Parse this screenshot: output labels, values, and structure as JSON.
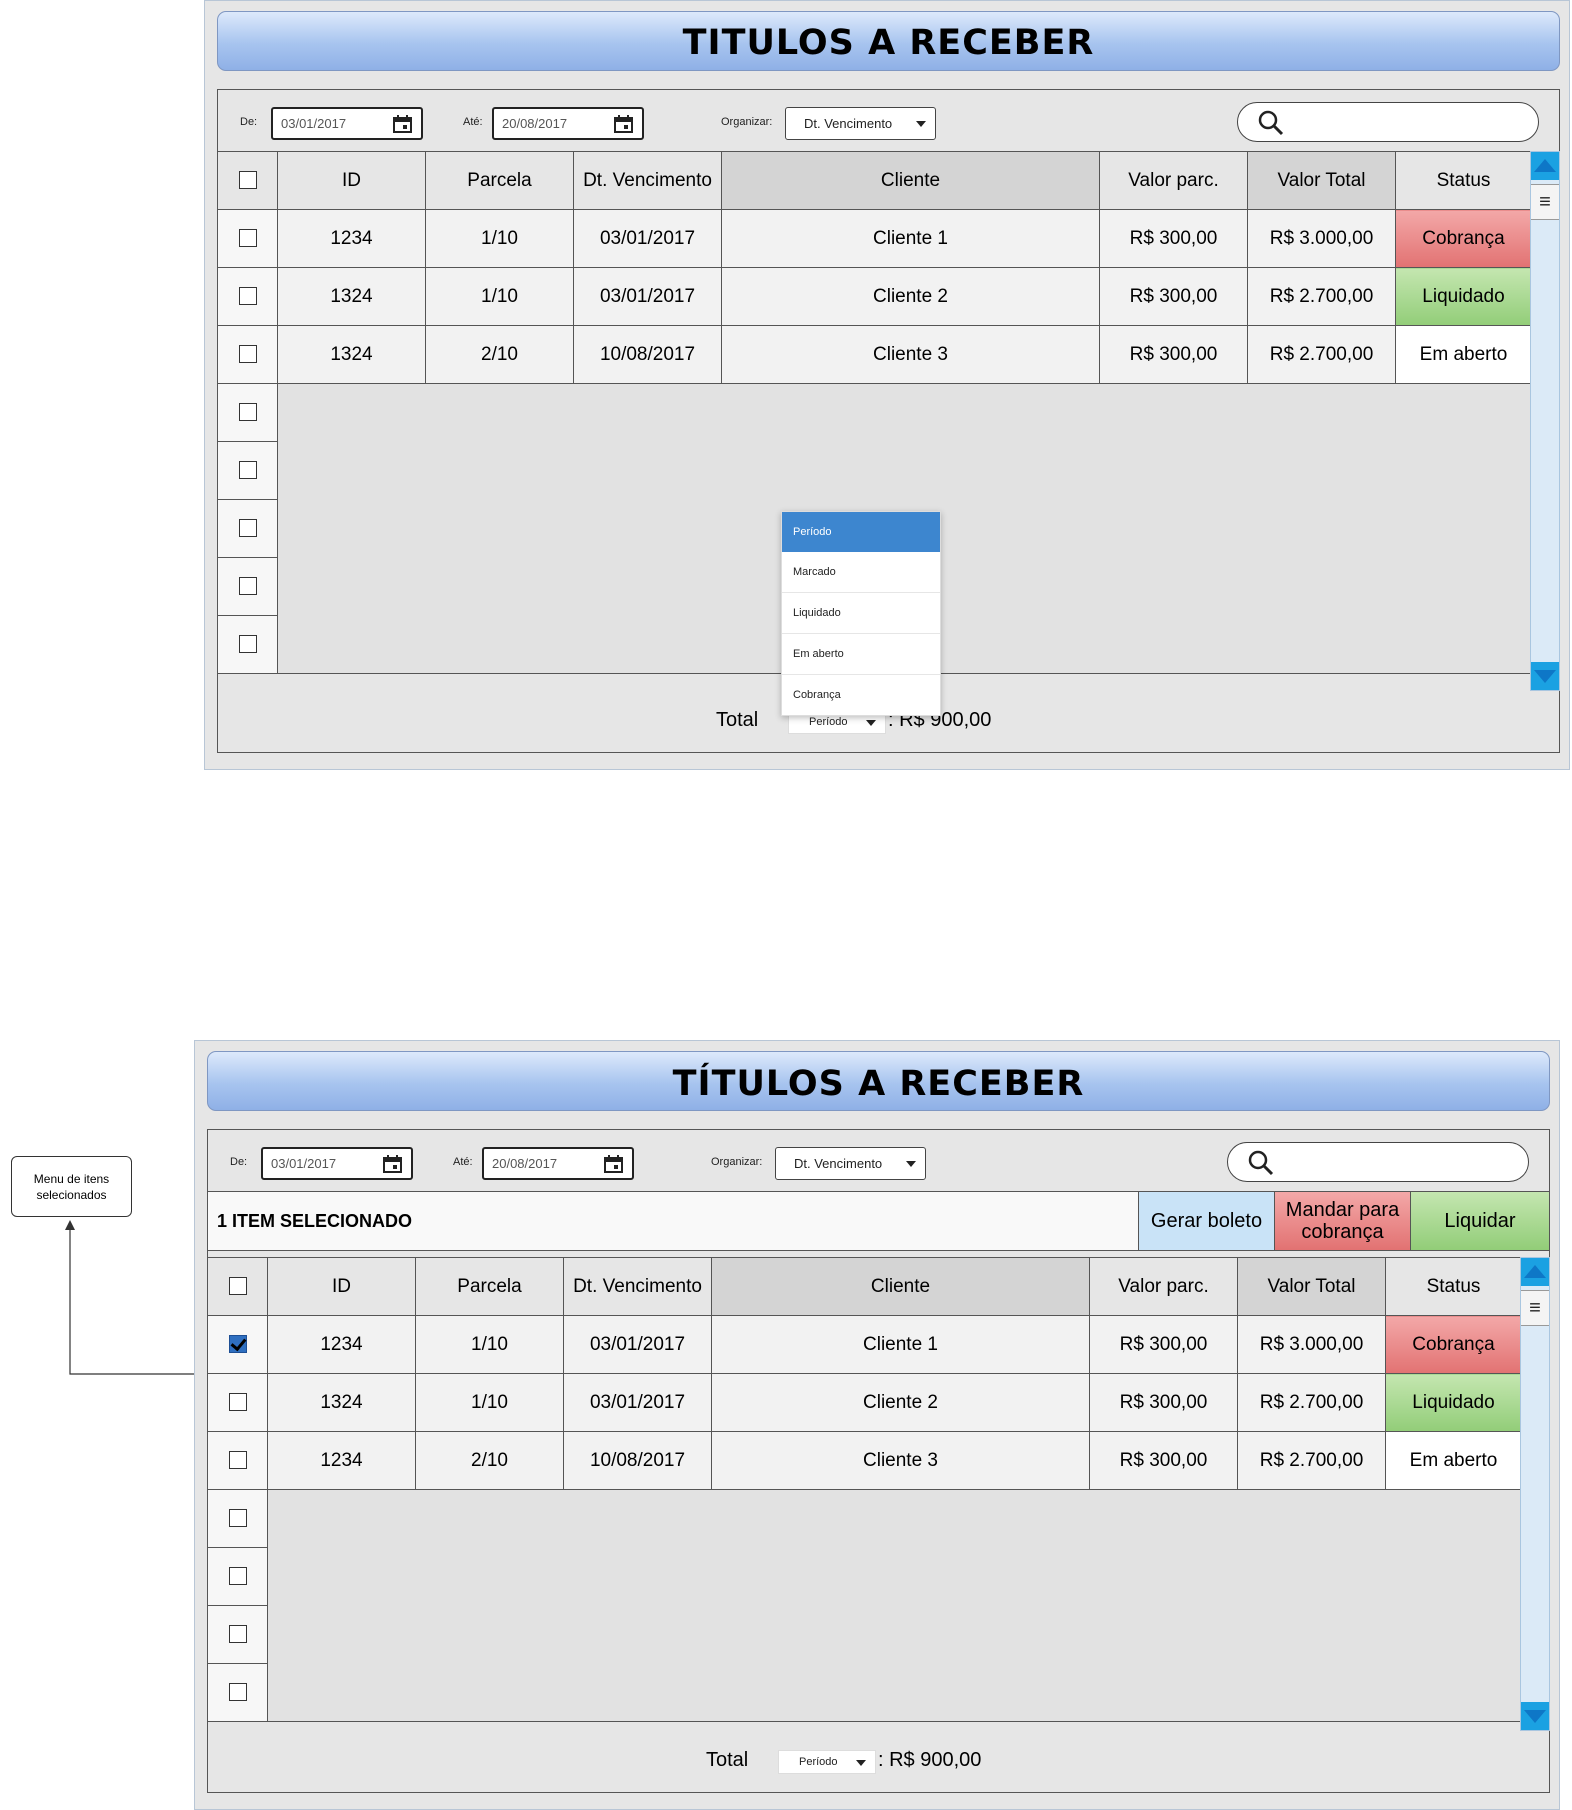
{
  "screen1": {
    "title": "TITULOS A RECEBER",
    "filters": {
      "from_label": "De:",
      "from_value": "03/01/2017",
      "to_label": "Até:",
      "to_value": "20/08/2017",
      "organize_label": "Organizar:",
      "organize_value": "Dt. Vencimento",
      "search_value": ""
    },
    "columns": [
      "ID",
      "Parcela",
      "Dt. Vencimento",
      "Cliente",
      "Valor parc.",
      "Valor Total",
      "Status"
    ],
    "rows": [
      {
        "id": "1234",
        "parcela": "1/10",
        "vencimento": "03/01/2017",
        "cliente": "Cliente 1",
        "valor_parc": "R$ 300,00",
        "valor_total": "R$ 3.000,00",
        "status": "Cobrança",
        "checked": false
      },
      {
        "id": "1324",
        "parcela": "1/10",
        "vencimento": "03/01/2017",
        "cliente": "Cliente 2",
        "valor_parc": "R$ 300,00",
        "valor_total": "R$ 2.700,00",
        "status": "Liquidado",
        "checked": false
      },
      {
        "id": "1324",
        "parcela": "2/10",
        "vencimento": "10/08/2017",
        "cliente": "Cliente 3",
        "valor_parc": "R$ 300,00",
        "valor_total": "R$ 2.700,00",
        "status": "Em aberto",
        "checked": false
      }
    ],
    "empty_rows": 5,
    "total": {
      "label": "Total",
      "period_value": "Período",
      "amount": ": R$ 900,00"
    },
    "period_dropdown": [
      "Período",
      "Marcado",
      "Liquidado",
      "Em aberto",
      "Cobrança"
    ]
  },
  "screen2": {
    "title": "TÍTULOS A RECEBER",
    "filters": {
      "from_label": "De:",
      "from_value": "03/01/2017",
      "to_label": "Até:",
      "to_value": "20/08/2017",
      "organize_label": "Organizar:",
      "organize_value": "Dt. Vencimento",
      "search_value": ""
    },
    "selection_bar": {
      "label": "1 ITEM SELECIONADO",
      "actions": [
        "Gerar boleto",
        "Mandar para cobrança",
        "Liquidar"
      ]
    },
    "columns": [
      "ID",
      "Parcela",
      "Dt. Vencimento",
      "Cliente",
      "Valor parc.",
      "Valor Total",
      "Status"
    ],
    "rows": [
      {
        "id": "1234",
        "parcela": "1/10",
        "vencimento": "03/01/2017",
        "cliente": "Cliente 1",
        "valor_parc": "R$ 300,00",
        "valor_total": "R$ 3.000,00",
        "status": "Cobrança",
        "checked": true
      },
      {
        "id": "1324",
        "parcela": "1/10",
        "vencimento": "03/01/2017",
        "cliente": "Cliente 2",
        "valor_parc": "R$ 300,00",
        "valor_total": "R$ 2.700,00",
        "status": "Liquidado",
        "checked": false
      },
      {
        "id": "1234",
        "parcela": "2/10",
        "vencimento": "10/08/2017",
        "cliente": "Cliente 3",
        "valor_parc": "R$ 300,00",
        "valor_total": "R$ 2.700,00",
        "status": "Em aberto",
        "checked": false
      }
    ],
    "empty_rows": 4,
    "total": {
      "label": "Total",
      "period_value": "Período",
      "amount": ": R$ 900,00"
    }
  },
  "annotation": {
    "text": "Menu de itens selecionados"
  },
  "colors": {
    "status_cobranca": "#e27272",
    "status_liquidado": "#92cd78",
    "scroll_accent": "#1ba1e2",
    "dropdown_selected": "#3d86cf",
    "btn_gerar_boleto": "#c9e3f7"
  },
  "icons": [
    "calendar-icon",
    "search-icon",
    "chevron-down-icon",
    "scroll-up-icon",
    "scroll-down-icon",
    "menu-lines-icon",
    "checkbox-icon",
    "arrow-up-icon"
  ]
}
